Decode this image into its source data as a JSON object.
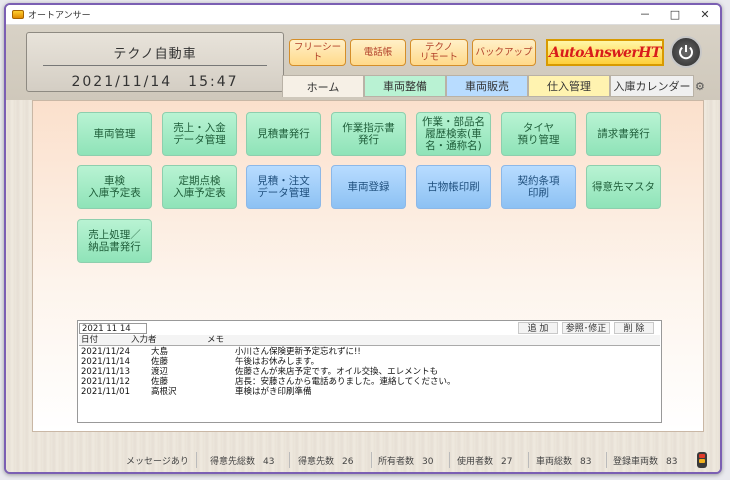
{
  "window": {
    "title": "オートアンサー",
    "minimize": "－",
    "maximize": "□",
    "close": "✕"
  },
  "header": {
    "company": "テクノ自動車",
    "datetime": "2021/11/14　15:47",
    "buttons": [
      {
        "label": "フリーシート"
      },
      {
        "label": "電話帳"
      },
      {
        "label": "テクノ\nリモート"
      },
      {
        "label": "バックアップ"
      }
    ],
    "logo_text": "AutoAnswerHT",
    "power_icon": "power-icon"
  },
  "tabs": [
    "ホーム",
    "車両整備",
    "車両販売",
    "仕入管理",
    "入庫カレンダー"
  ],
  "tab_colors": [
    "#f6f0e6",
    "#b9f2d3",
    "#b8dcff",
    "#fff3b0",
    "#f0f0f0"
  ],
  "functions": [
    {
      "label": "車両管理",
      "style": "green"
    },
    {
      "label": "売上・入金\nデータ管理",
      "style": "green"
    },
    {
      "label": "見積書発行",
      "style": "green"
    },
    {
      "label": "作業指示書\n発行",
      "style": "green"
    },
    {
      "label": "作業・部品名\n履歴検索(車\n名・通称名)",
      "style": "green"
    },
    {
      "label": "タイヤ\n預り管理",
      "style": "green"
    },
    {
      "label": "請求書発行",
      "style": "green"
    },
    {
      "label": "車検\n入庫予定表",
      "style": "green"
    },
    {
      "label": "定期点検\n入庫予定表",
      "style": "green"
    },
    {
      "label": "見積・注文\nデータ管理",
      "style": "blue"
    },
    {
      "label": "車両登録",
      "style": "blue"
    },
    {
      "label": "古物帳印刷",
      "style": "blue"
    },
    {
      "label": "契約条項\n印刷",
      "style": "blue"
    },
    {
      "label": "得意先マスタ",
      "style": "green"
    },
    {
      "label": "売上処理／\n納品書発行",
      "style": "green"
    }
  ],
  "messages": {
    "date_field": "2021 11 14",
    "add_label": "追 加",
    "view_label": "参照･修正",
    "delete_label": "削 除",
    "columns": [
      "日付",
      "入力者",
      "メモ"
    ],
    "rows": [
      {
        "date": "2021/11/24",
        "author": "大島",
        "memo": "小川さん保険更新予定忘れずに!!"
      },
      {
        "date": "2021/11/14",
        "author": "佐藤",
        "memo": "午後はお休みします。"
      },
      {
        "date": "2021/11/13",
        "author": "渡辺",
        "memo": "佐藤さんが来店予定です。オイル交換、エレメントも"
      },
      {
        "date": "2021/11/12",
        "author": "佐藤",
        "memo": "店長：安藤さんから電話ありました。連絡してください。"
      },
      {
        "date": "2021/11/01",
        "author": "高根沢",
        "memo": "車検はがき印刷準備"
      }
    ]
  },
  "status_bar": {
    "message_label": "メッセージあり",
    "stats": [
      {
        "label": "得意先総数",
        "value": "43"
      },
      {
        "label": "得意先数",
        "value": "26"
      },
      {
        "label": "所有者数",
        "value": "30"
      },
      {
        "label": "使用者数",
        "value": "27"
      },
      {
        "label": "車両総数",
        "value": "83"
      },
      {
        "label": "登録車両数",
        "value": "83"
      }
    ]
  }
}
